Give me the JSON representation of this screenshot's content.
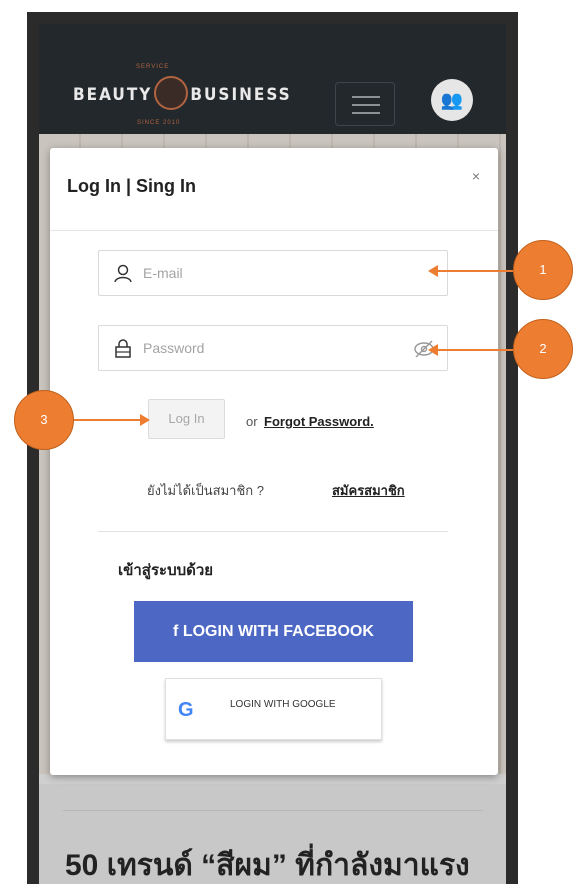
{
  "header": {
    "logo_left": "BEAUTY",
    "logo_right": "BUSINESS",
    "logo_top": "SERVICE",
    "logo_bottom": "SINCE 2010"
  },
  "modal": {
    "title": "Log In | Sing In",
    "close": "×",
    "email_placeholder": "E-mail",
    "password_placeholder": "Password",
    "login_button": "Log In",
    "or_text": "or",
    "forgot_link": "Forgot Password.",
    "not_member_text": "ยังไม่ได้เป็นสมาชิก ?",
    "register_link": "สมัครสมาชิก",
    "login_via": "เข้าสู่ระบบด้วย",
    "facebook_button": "LOGIN WITH FACEBOOK",
    "facebook_icon": "f",
    "google_button": "LOGIN WITH GOOGLE",
    "google_icon": "G"
  },
  "page": {
    "headline": "50 เทรนด์ “สีผม” ที่กำลังมาแรง"
  },
  "callouts": [
    "1",
    "2",
    "3"
  ],
  "colors": {
    "callout": "#ed7d31",
    "facebook": "#4d67c4",
    "topbar": "#23282d"
  }
}
